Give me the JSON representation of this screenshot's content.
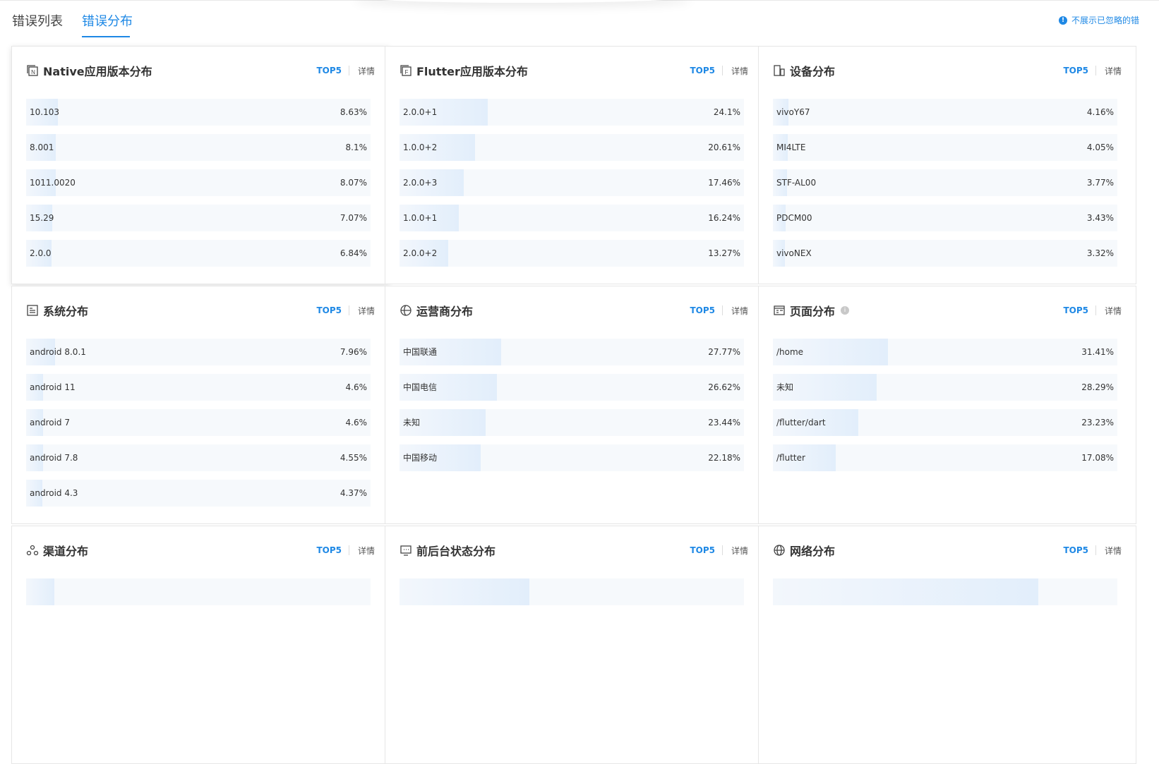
{
  "tabs": [
    {
      "label": "错误列表",
      "active": false
    },
    {
      "label": "错误分布",
      "active": true
    }
  ],
  "notice": {
    "text": "不展示已忽略的错"
  },
  "cards": [
    {
      "title": "Native应用版本分布",
      "icon": "native-version-icon",
      "top5": "TOP5",
      "detail": "详情",
      "rows": [
        {
          "label": "10.103",
          "pct": "8.63%",
          "value": 8.63
        },
        {
          "label": "8.001",
          "pct": "8.1%",
          "value": 8.1
        },
        {
          "label": "1011.0020",
          "pct": "8.07%",
          "value": 8.07
        },
        {
          "label": "15.29",
          "pct": "7.07%",
          "value": 7.07
        },
        {
          "label": "2.0.0",
          "pct": "6.84%",
          "value": 6.84
        }
      ]
    },
    {
      "title": "Flutter应用版本分布",
      "icon": "flutter-version-icon",
      "top5": "TOP5",
      "detail": "详情",
      "rows": [
        {
          "label": "2.0.0+1",
          "pct": "24.1%",
          "value": 24.1
        },
        {
          "label": "1.0.0+2",
          "pct": "20.61%",
          "value": 20.61
        },
        {
          "label": "2.0.0+3",
          "pct": "17.46%",
          "value": 17.46
        },
        {
          "label": "1.0.0+1",
          "pct": "16.24%",
          "value": 16.24
        },
        {
          "label": "2.0.0+2",
          "pct": "13.27%",
          "value": 13.27
        }
      ]
    },
    {
      "title": "设备分布",
      "icon": "device-icon",
      "top5": "TOP5",
      "detail": "详情",
      "rows": [
        {
          "label": "vivoY67",
          "pct": "4.16%",
          "value": 4.16
        },
        {
          "label": "MI4LTE",
          "pct": "4.05%",
          "value": 4.05
        },
        {
          "label": "STF-AL00",
          "pct": "3.77%",
          "value": 3.77
        },
        {
          "label": "PDCM00",
          "pct": "3.43%",
          "value": 3.43
        },
        {
          "label": "vivoNEX",
          "pct": "3.32%",
          "value": 3.32
        }
      ]
    },
    {
      "title": "系统分布",
      "icon": "system-icon",
      "top5": "TOP5",
      "detail": "详情",
      "rows": [
        {
          "label": "android 8.0.1",
          "pct": "7.96%",
          "value": 7.96
        },
        {
          "label": "android 11",
          "pct": "4.6%",
          "value": 4.6
        },
        {
          "label": "android 7",
          "pct": "4.6%",
          "value": 4.6
        },
        {
          "label": "android 7.8",
          "pct": "4.55%",
          "value": 4.55
        },
        {
          "label": "android 4.3",
          "pct": "4.37%",
          "value": 4.37
        }
      ]
    },
    {
      "title": "运营商分布",
      "icon": "carrier-icon",
      "top5": "TOP5",
      "detail": "详情",
      "rows": [
        {
          "label": "中国联通",
          "pct": "27.77%",
          "value": 27.77
        },
        {
          "label": "中国电信",
          "pct": "26.62%",
          "value": 26.62
        },
        {
          "label": "未知",
          "pct": "23.44%",
          "value": 23.44
        },
        {
          "label": "中国移动",
          "pct": "22.18%",
          "value": 22.18
        }
      ]
    },
    {
      "title": "页面分布",
      "icon": "page-icon",
      "info": true,
      "top5": "TOP5",
      "detail": "详情",
      "rows": [
        {
          "label": "/home",
          "pct": "31.41%",
          "value": 31.41
        },
        {
          "label": "未知",
          "pct": "28.29%",
          "value": 28.29
        },
        {
          "label": "/flutter/dart",
          "pct": "23.23%",
          "value": 23.23
        },
        {
          "label": "/flutter",
          "pct": "17.08%",
          "value": 17.08
        }
      ]
    },
    {
      "title": "渠道分布",
      "icon": "channel-icon",
      "top5": "TOP5",
      "detail": "详情",
      "rows": [
        {
          "value": 7.72
        }
      ]
    },
    {
      "title": "前后台状态分布",
      "icon": "foreground-state-icon",
      "top5": "TOP5",
      "detail": "详情",
      "rows": [
        {
          "value": 35.44
        }
      ]
    },
    {
      "title": "网络分布",
      "icon": "network-icon",
      "top5": "TOP5",
      "detail": "详情",
      "rows": [
        {
          "value": 72.33
        }
      ]
    }
  ],
  "colors": {
    "accent": "#1e88e5",
    "bar_fill_end": "#e2eefb",
    "row_bg": "#f6f9fc"
  }
}
